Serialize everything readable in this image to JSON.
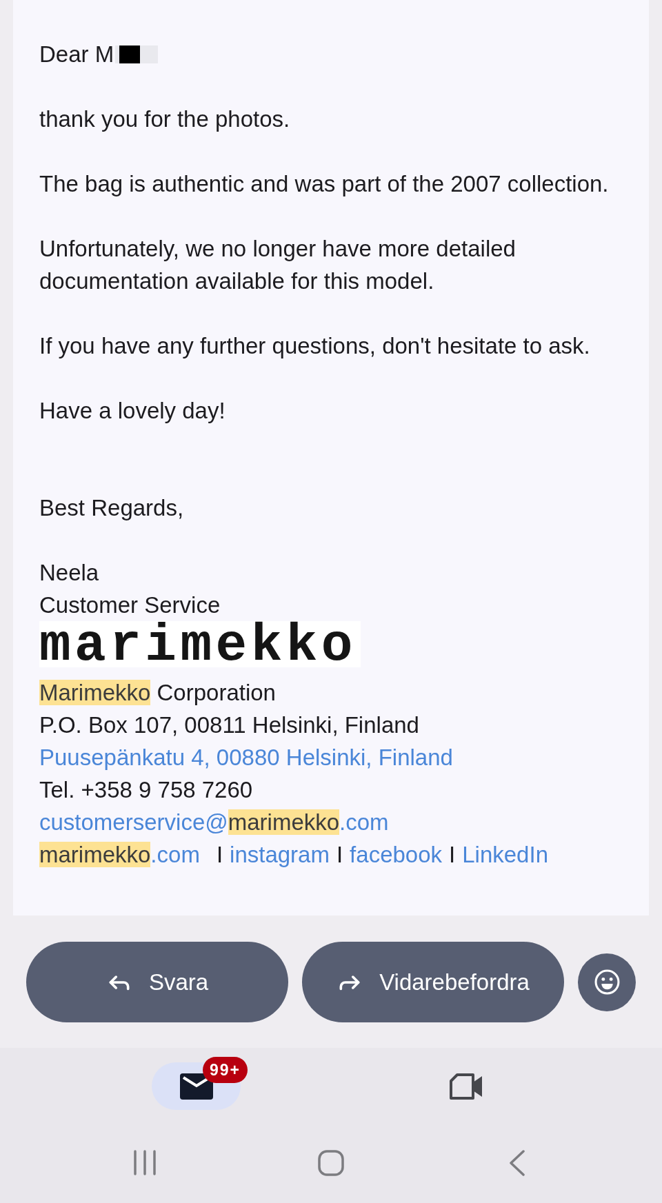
{
  "email": {
    "salutation": "Dear M",
    "paragraphs": [
      "thank you for the photos.",
      "The bag is authentic and was part of the 2007 collection.",
      "Unfortunately, we no longer have more detailed documentation available for this model.",
      "If you have any further questions, don't hesitate to ask.",
      "Have a lovely day!"
    ],
    "closing": "Best Regards,",
    "signature": {
      "name": "Neela",
      "role": "Customer Service",
      "logo": "marimekko",
      "lines": [
        {
          "items": [
            {
              "kind": "company",
              "parts": [
                {
                  "text": "Marimekko",
                  "highlighted": true
                },
                {
                  "text": " Corporation",
                  "highlighted": false
                }
              ]
            }
          ]
        },
        {
          "items": [
            {
              "kind": "postal_address",
              "parts": [
                {
                  "text": "P.O. Box 107, 00811 Helsinki, Finland",
                  "highlighted": false
                }
              ]
            }
          ]
        },
        {
          "items": [
            {
              "kind": "street_address",
              "parts": [
                {
                  "text": "Puusepänkatu 4, 00880 Helsinki, Finland",
                  "highlighted": false
                }
              ]
            }
          ]
        },
        {
          "items": [
            {
              "kind": "phone",
              "parts": [
                {
                  "text": "Tel. +358 9 758 7260",
                  "highlighted": false
                }
              ]
            }
          ]
        },
        {
          "items": [
            {
              "kind": "email",
              "parts": [
                {
                  "text": "customerservice@",
                  "highlighted": false
                },
                {
                  "text": "marimekko",
                  "highlighted": true
                },
                {
                  "text": ".com",
                  "highlighted": false
                }
              ]
            }
          ]
        },
        {
          "items": [
            {
              "kind": "website",
              "parts": [
                {
                  "text": "marimekko",
                  "highlighted": true
                },
                {
                  "text": ".com",
                  "highlighted": false
                }
              ]
            },
            {
              "kind": "separator",
              "parts": [
                {
                  "text": "I",
                  "highlighted": false
                }
              ]
            },
            {
              "kind": "instagram",
              "parts": [
                {
                  "text": "instagram",
                  "highlighted": false
                }
              ]
            },
            {
              "kind": "separator",
              "parts": [
                {
                  "text": "I",
                  "highlighted": false
                }
              ]
            },
            {
              "kind": "facebook",
              "parts": [
                {
                  "text": "facebook",
                  "highlighted": false
                }
              ]
            },
            {
              "kind": "separator",
              "parts": [
                {
                  "text": "I",
                  "highlighted": false
                }
              ]
            },
            {
              "kind": "linkedin",
              "parts": [
                {
                  "text": "LinkedIn",
                  "highlighted": false
                }
              ]
            }
          ]
        }
      ]
    }
  },
  "actions": [
    {
      "kind": "reply",
      "label": "Svara"
    },
    {
      "kind": "forward",
      "label": "Vidarebefordra"
    },
    {
      "kind": "emoji"
    }
  ],
  "bottom_nav": [
    {
      "kind": "mail",
      "selected": true,
      "badge": "99+"
    },
    {
      "kind": "video",
      "selected": false
    }
  ]
}
